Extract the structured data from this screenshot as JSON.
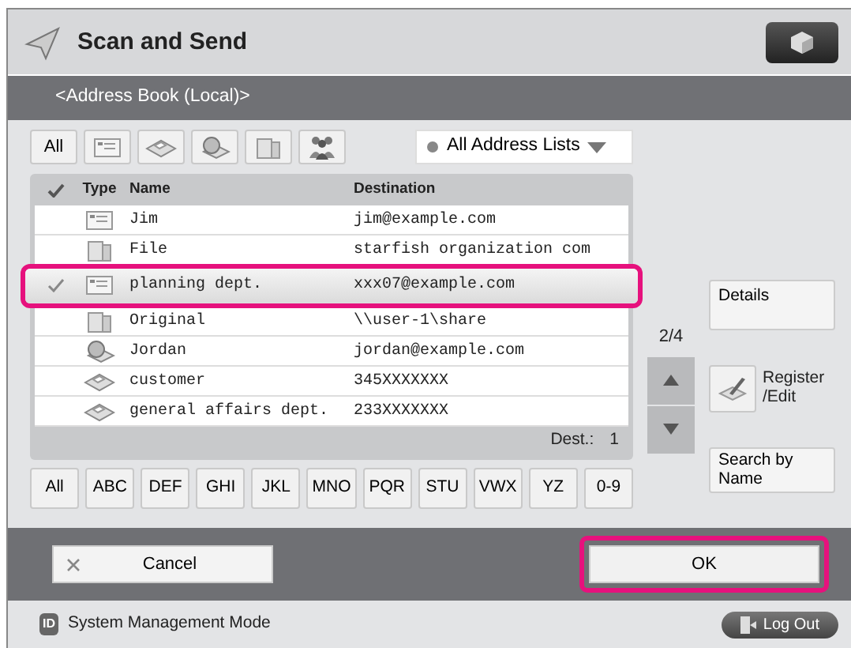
{
  "window": {
    "title": "Scan and Send"
  },
  "subheader": "<Address Book (Local)>",
  "type_filters": [
    {
      "kind": "all",
      "label": "All"
    },
    {
      "kind": "email"
    },
    {
      "kind": "fax"
    },
    {
      "kind": "ifax"
    },
    {
      "kind": "file"
    },
    {
      "kind": "group"
    }
  ],
  "address_list": {
    "value": "All Address Lists"
  },
  "table": {
    "columns": [
      "Type",
      "Name",
      "Destination"
    ],
    "rows": [
      {
        "kind": "email",
        "name": "Jim",
        "destination": "jim@example.com",
        "selected": false
      },
      {
        "kind": "file",
        "name": "File",
        "destination": "starfish organization com",
        "selected": false
      },
      {
        "kind": "email",
        "name": "planning dept.",
        "destination": "xxx07@example.com",
        "selected": true
      },
      {
        "kind": "file",
        "name": "Original",
        "destination": "\\\\user-1\\share",
        "selected": false
      },
      {
        "kind": "ifax",
        "name": "Jordan",
        "destination": "jordan@example.com",
        "selected": false
      },
      {
        "kind": "fax",
        "name": "customer",
        "destination": "345XXXXXXX",
        "selected": false
      },
      {
        "kind": "fax",
        "name": "general affairs dept.",
        "destination": "233XXXXXXX",
        "selected": false
      }
    ]
  },
  "dest_count": {
    "label": "Dest.:",
    "value": "1"
  },
  "page_indicator": "2/4",
  "letter_tabs": [
    "All",
    "ABC",
    "DEF",
    "GHI",
    "JKL",
    "MNO",
    "PQR",
    "STU",
    "VWX",
    "YZ",
    "0-9"
  ],
  "side_buttons": {
    "details": "Details",
    "register_edit": [
      "Register",
      "/Edit"
    ],
    "search_by_name": "Search by Name"
  },
  "footer": {
    "cancel": "Cancel",
    "ok": "OK"
  },
  "status_bar": {
    "badge": "ID",
    "mode": "System Management Mode",
    "logout": "Log Out"
  }
}
